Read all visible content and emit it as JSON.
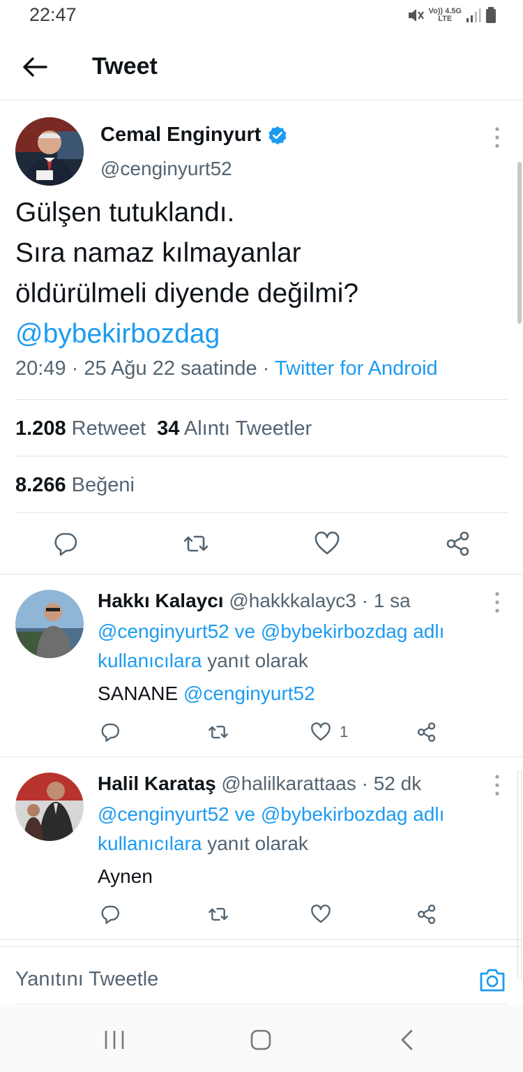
{
  "status_bar": {
    "time": "22:47",
    "network_top": "Vo)) 4.5G",
    "network_bottom": "LTE"
  },
  "header": {
    "title": "Tweet"
  },
  "main_tweet": {
    "name": "Cemal Enginyurt",
    "handle": "@cenginyurt52",
    "text_lines": [
      "Gülşen tutuklandı.",
      "Sıra namaz kılmayanlar",
      "öldürülmeli diyende değilmi?"
    ],
    "mention": "@bybekirbozdag",
    "time": "20:49",
    "date": "25 Ağu 22 saatinde",
    "source": "Twitter for Android",
    "retweet_count": "1.208",
    "retweet_label": "Retweet",
    "quote_count": "34",
    "quote_label": "Alıntı Tweetler",
    "like_count": "8.266",
    "like_label": "Beğeni"
  },
  "replies": [
    {
      "name": "Hakkı Kalaycı",
      "handle": "@hakkkalayc3",
      "time": "1 sa",
      "context_mention1": "@cenginyurt52",
      "context_ve": "ve",
      "context_mention2": "@bybekirbozdag",
      "context_adli": "adlı",
      "context_users": "kullanıcılara",
      "context_suffix": "yanıt olarak",
      "body_text": "SANANE",
      "body_mention": "@cenginyurt52",
      "like_count": "1"
    },
    {
      "name": "Halil Karataş",
      "handle": "@halilkarattaas",
      "time": "52 dk",
      "context_mention1": "@cenginyurt52",
      "context_ve": "ve",
      "context_mention2": "@bybekirbozdag",
      "context_adli": "adlı",
      "context_users": "kullanıcılara",
      "context_suffix": "yanıt olarak",
      "body_text": "Aynen",
      "like_count": ""
    }
  ],
  "compose": {
    "placeholder": "Yanıtını Tweetle"
  },
  "colors": {
    "accent": "#1d9bf0",
    "text": "#0f1419",
    "secondary": "#536471"
  }
}
